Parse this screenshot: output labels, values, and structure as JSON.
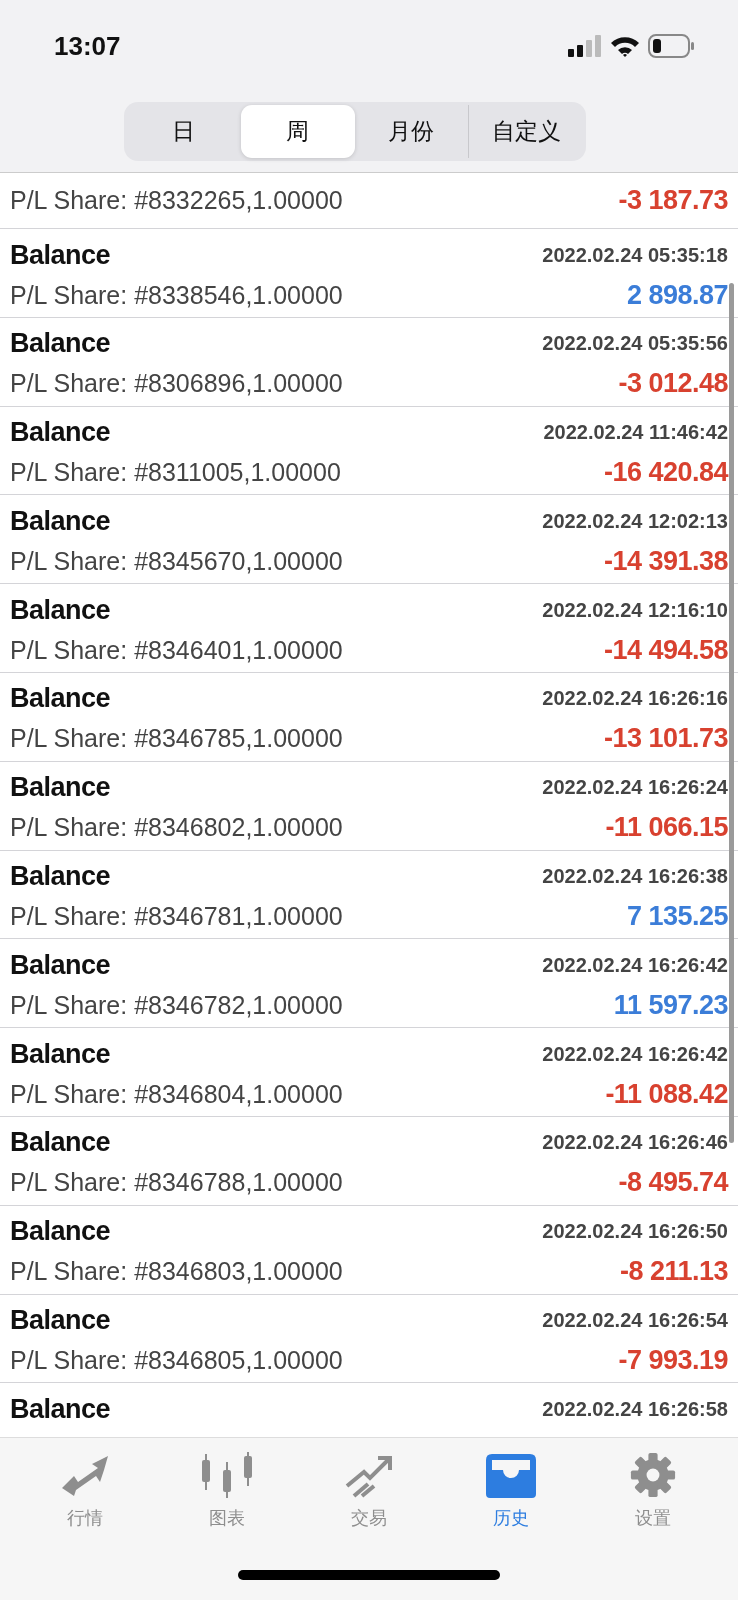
{
  "status_bar": {
    "time": "13:07"
  },
  "segments": [
    {
      "label": "日",
      "selected": false
    },
    {
      "label": "周",
      "selected": true
    },
    {
      "label": "月份",
      "selected": false
    },
    {
      "label": "自定义",
      "selected": false
    }
  ],
  "rows": [
    {
      "detail": "P/L Share: #8332265,1.00000",
      "amount": "-3 187.73",
      "color": "#d8412f"
    },
    {
      "title": "Balance",
      "time": "2022.02.24 05:35:18",
      "detail": "P/L Share: #8338546,1.00000",
      "amount": "2 898.87",
      "color": "#3b7dd8"
    },
    {
      "title": "Balance",
      "time": "2022.02.24 05:35:56",
      "detail": "P/L Share: #8306896,1.00000",
      "amount": "-3 012.48",
      "color": "#d8412f"
    },
    {
      "title": "Balance",
      "time": "2022.02.24 11:46:42",
      "detail": "P/L Share: #8311005,1.00000",
      "amount": "-16 420.84",
      "color": "#d8412f"
    },
    {
      "title": "Balance",
      "time": "2022.02.24 12:02:13",
      "detail": "P/L Share: #8345670,1.00000",
      "amount": "-14 391.38",
      "color": "#d8412f"
    },
    {
      "title": "Balance",
      "time": "2022.02.24 12:16:10",
      "detail": "P/L Share: #8346401,1.00000",
      "amount": "-14 494.58",
      "color": "#d8412f"
    },
    {
      "title": "Balance",
      "time": "2022.02.24 16:26:16",
      "detail": "P/L Share: #8346785,1.00000",
      "amount": "-13 101.73",
      "color": "#d8412f"
    },
    {
      "title": "Balance",
      "time": "2022.02.24 16:26:24",
      "detail": "P/L Share: #8346802,1.00000",
      "amount": "-11 066.15",
      "color": "#d8412f"
    },
    {
      "title": "Balance",
      "time": "2022.02.24 16:26:38",
      "detail": "P/L Share: #8346781,1.00000",
      "amount": "7 135.25",
      "color": "#3b7dd8"
    },
    {
      "title": "Balance",
      "time": "2022.02.24 16:26:42",
      "detail": "P/L Share: #8346782,1.00000",
      "amount": "11 597.23",
      "color": "#3b7dd8"
    },
    {
      "title": "Balance",
      "time": "2022.02.24 16:26:42",
      "detail": "P/L Share: #8346804,1.00000",
      "amount": "-11 088.42",
      "color": "#d8412f"
    },
    {
      "title": "Balance",
      "time": "2022.02.24 16:26:46",
      "detail": "P/L Share: #8346788,1.00000",
      "amount": "-8 495.74",
      "color": "#d8412f"
    },
    {
      "title": "Balance",
      "time": "2022.02.24 16:26:50",
      "detail": "P/L Share: #8346803,1.00000",
      "amount": "-8 211.13",
      "color": "#d8412f"
    },
    {
      "title": "Balance",
      "time": "2022.02.24 16:26:54",
      "detail": "P/L Share: #8346805,1.00000",
      "amount": "-7 993.19",
      "color": "#d8412f"
    },
    {
      "title": "Balance",
      "time": "2022.02.24 16:26:58"
    }
  ],
  "tab_bar": [
    {
      "label": "行情",
      "kind": "quotes",
      "selected": false
    },
    {
      "label": "图表",
      "kind": "chart",
      "selected": false
    },
    {
      "label": "交易",
      "kind": "trade",
      "selected": false
    },
    {
      "label": "历史",
      "kind": "history",
      "selected": true
    },
    {
      "label": "设置",
      "kind": "settings",
      "selected": false
    }
  ]
}
